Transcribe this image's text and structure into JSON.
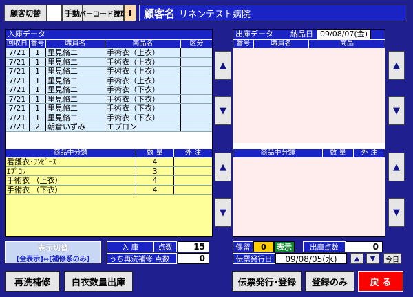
{
  "toolbar": {
    "customer_switch": "顧客切替",
    "manual": "手動",
    "barcode": "バーコード読取",
    "indicator": "I"
  },
  "customer": {
    "label": "顧客名",
    "name": "リネンテスト病院"
  },
  "incoming": {
    "title": "入庫データ",
    "headers": [
      "回収日",
      "番号",
      "職員名",
      "商品名",
      "区分"
    ],
    "rows": [
      [
        "7/21",
        "1",
        "里見脩二",
        "手術衣（上衣）",
        ""
      ],
      [
        "7/21",
        "1",
        "里見脩二",
        "手術衣（上衣）",
        ""
      ],
      [
        "7/21",
        "1",
        "里見脩二",
        "手術衣（上衣）",
        ""
      ],
      [
        "7/21",
        "1",
        "里見脩二",
        "手術衣（上衣）",
        ""
      ],
      [
        "7/21",
        "1",
        "里見脩二",
        "手術衣（下衣）",
        ""
      ],
      [
        "7/21",
        "1",
        "里見脩二",
        "手術衣（下衣）",
        ""
      ],
      [
        "7/21",
        "1",
        "里見脩二",
        "手術衣（下衣）",
        ""
      ],
      [
        "7/21",
        "1",
        "里見脩二",
        "手術衣（下衣）",
        ""
      ],
      [
        "7/21",
        "2",
        "朝倉いずみ",
        "エプロン",
        ""
      ]
    ],
    "cat_headers": [
      "商品中分類",
      "数 量",
      "外 注"
    ],
    "categories": [
      [
        "看護衣･ﾜﾝﾋﾟｰｽ",
        "4",
        ""
      ],
      [
        "ｴﾌﾟﾛﾝ",
        "3",
        ""
      ],
      [
        "手術衣 （上衣）",
        "4",
        ""
      ],
      [
        "手術衣 （下衣）",
        "4",
        ""
      ]
    ]
  },
  "outgoing": {
    "title": "出庫データ",
    "date_label": "納品日",
    "date_value": "09/08/07(金)",
    "headers": [
      "番号",
      "職員名",
      "商品"
    ],
    "cat_headers": [
      "商品中分類",
      "数 量",
      "外 注"
    ]
  },
  "display_toggle": {
    "title": "表示切替",
    "sub": "[全表示]⇔[補修系のみ]"
  },
  "stats": {
    "in_label": "入 庫",
    "points_label": "点数",
    "in_points": "15",
    "rewash_label": "うち再洗補修 点数",
    "rewash_points": "0",
    "hold_label": "保留",
    "hold_value": "0",
    "show_label": "表示",
    "out_points_label": "出庫点数",
    "out_points": "0",
    "slip_date_label": "伝票発行日",
    "slip_date": "09/08/05(水)",
    "today": "今日"
  },
  "buttons": {
    "rewash": "再洗補修",
    "white_coat": "白衣数量出庫",
    "issue": "伝票発行･登録",
    "register": "登録のみ",
    "back": "戻 る"
  },
  "colors": {
    "back_button": "#ff0000",
    "accent": "#1a24c4"
  }
}
